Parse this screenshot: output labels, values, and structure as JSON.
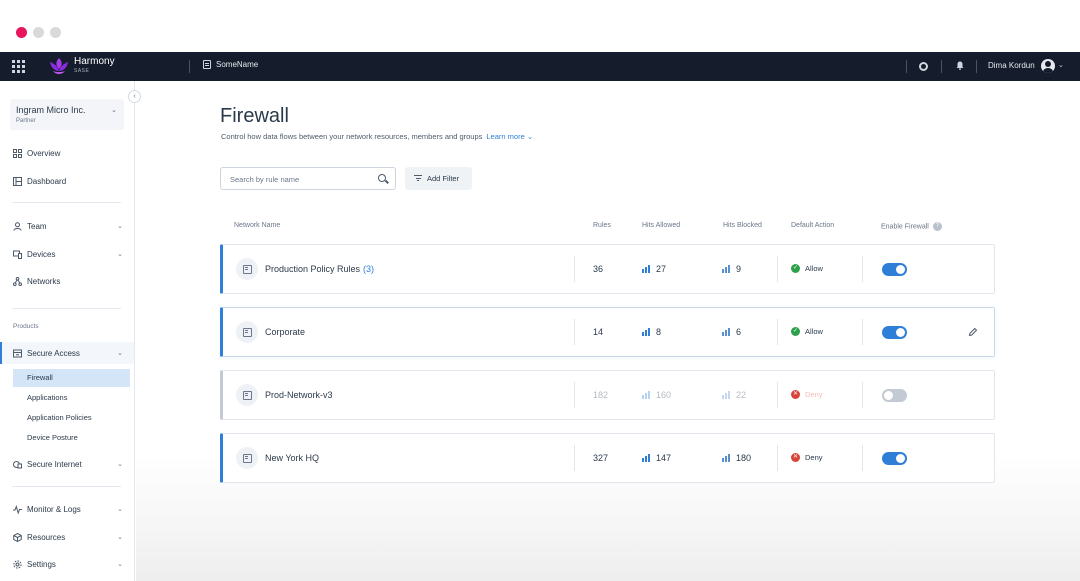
{
  "app": {
    "name": "Harmony",
    "sub": "SASE",
    "brand_color": "#8a2be2"
  },
  "topbar": {
    "tenant": "SomeName",
    "user": "Dima Kordun"
  },
  "sidebar": {
    "org_name": "Ingram Micro Inc.",
    "org_role": "Partner",
    "items": [
      {
        "label": "Overview",
        "icon": "overview-icon"
      },
      {
        "label": "Dashboard",
        "icon": "dashboard-icon"
      },
      {
        "label": "Team",
        "icon": "team-icon"
      },
      {
        "label": "Devices",
        "icon": "devices-icon"
      },
      {
        "label": "Networks",
        "icon": "networks-icon"
      }
    ],
    "products_label": "Products",
    "secure_access": "Secure Access",
    "sub_items": [
      "Firewall",
      "Applications",
      "Application Policies",
      "Device Posture"
    ],
    "secure_internet": "Secure Internet",
    "bottom_items": [
      "Monitor & Logs",
      "Resources",
      "Settings"
    ]
  },
  "page": {
    "title": "Firewall",
    "description": "Control how data flows between your network resources, members and groups",
    "learn_more": "Learn more",
    "search_placeholder": "Search by rule name",
    "add_filter": "Add Filter"
  },
  "table": {
    "columns": [
      "Network Name",
      "Rules",
      "Hits Allowed",
      "Hits Blocked",
      "Default Action",
      "Enable Firewall"
    ],
    "rows": [
      {
        "name": "Production Policy Rules",
        "count": "(3)",
        "rules": "36",
        "allowed": "27",
        "blocked": "9",
        "action": "Allow",
        "enabled": true
      },
      {
        "name": "Corporate",
        "count": "",
        "rules": "14",
        "allowed": "8",
        "blocked": "6",
        "action": "Allow",
        "enabled": true
      },
      {
        "name": "Prod-Network-v3",
        "count": "",
        "rules": "182",
        "allowed": "160",
        "blocked": "22",
        "action": "Deny",
        "enabled": false
      },
      {
        "name": "New York HQ",
        "count": "",
        "rules": "327",
        "allowed": "147",
        "blocked": "180",
        "action": "Deny",
        "enabled": true
      }
    ]
  }
}
